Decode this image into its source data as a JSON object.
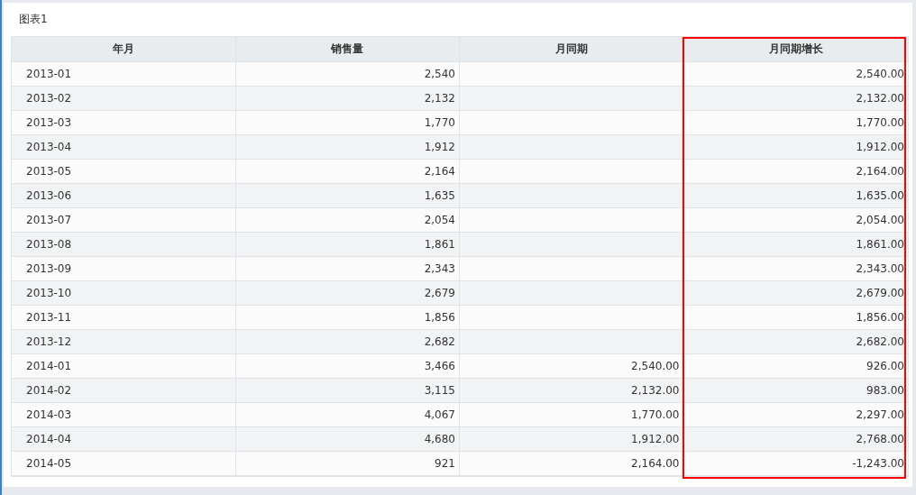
{
  "panel": {
    "title": "图表1"
  },
  "table": {
    "columns": [
      {
        "label": "年月",
        "highlighted": false
      },
      {
        "label": "销售量",
        "highlighted": false
      },
      {
        "label": "月同期",
        "highlighted": false
      },
      {
        "label": "月同期增长",
        "highlighted": true
      }
    ],
    "rows": [
      [
        "2013-01",
        "2,540",
        null,
        "2,540.00"
      ],
      [
        "2013-02",
        "2,132",
        null,
        "2,132.00"
      ],
      [
        "2013-03",
        "1,770",
        null,
        "1,770.00"
      ],
      [
        "2013-04",
        "1,912",
        null,
        "1,912.00"
      ],
      [
        "2013-05",
        "2,164",
        null,
        "2,164.00"
      ],
      [
        "2013-06",
        "1,635",
        null,
        "1,635.00"
      ],
      [
        "2013-07",
        "2,054",
        null,
        "2,054.00"
      ],
      [
        "2013-08",
        "1,861",
        null,
        "1,861.00"
      ],
      [
        "2013-09",
        "2,343",
        null,
        "2,343.00"
      ],
      [
        "2013-10",
        "2,679",
        null,
        "2,679.00"
      ],
      [
        "2013-11",
        "1,856",
        null,
        "1,856.00"
      ],
      [
        "2013-12",
        "2,682",
        null,
        "2,682.00"
      ],
      [
        "2014-01",
        "3,466",
        "2,540.00",
        "926.00"
      ],
      [
        "2014-02",
        "3,115",
        "2,132.00",
        "983.00"
      ],
      [
        "2014-03",
        "4,067",
        "1,770.00",
        "2,297.00"
      ],
      [
        "2014-04",
        "4,680",
        "1,912.00",
        "2,768.00"
      ],
      [
        "2014-05",
        "921",
        "2,164.00",
        "-1,243.00"
      ]
    ]
  }
}
